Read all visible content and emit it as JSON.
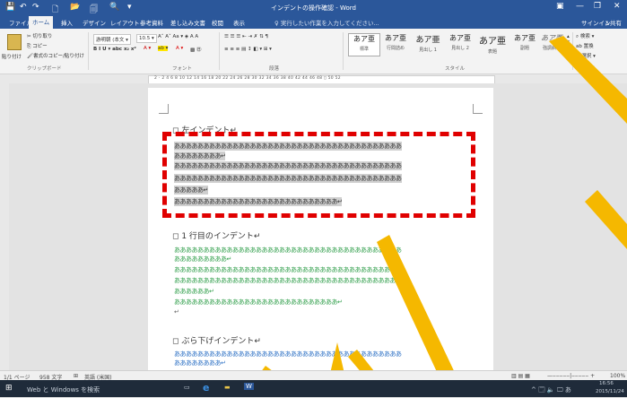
{
  "titlebar": {
    "title": "インデントの操作確認 - Word",
    "quick_access": [
      "💾",
      "↶",
      "↷",
      "🗋",
      "📂",
      "🗐",
      "🔍",
      "▾"
    ],
    "window_controls": [
      "▣",
      "—",
      "❐",
      "✕"
    ]
  },
  "tabs": [
    "ファイル",
    "ホーム",
    "挿入",
    "デザイン",
    "レイアウト",
    "参考資料",
    "差し込み文書",
    "校閲",
    "表示"
  ],
  "active_tab": "ホーム",
  "tellme": "実行したい作業を入力してください...",
  "account": {
    "signin": "サインイン",
    "share": "共有"
  },
  "ribbon": {
    "clipboard": {
      "paste": "貼り付け",
      "cut": "切り取り",
      "copy": "コピー",
      "format_painter": "書式のコピー/貼り付け",
      "label": "クリップボード"
    },
    "font": {
      "name": "游明朝 (本文 ▾",
      "size": "10.5 ▾",
      "label": "フォント",
      "row1_icons": "A˄ A˅ Aa ▾ ◈ A A",
      "row2_icons": "B I U ▾ abc x₂ x²"
    },
    "paragraph": {
      "label": "段落",
      "row1_icons": "☰ ☰ ☰ ⇤ ⇥ ✗ ⇅ ¶",
      "row2_icons": "≡ ≡ ≡ ▤ ↕ ◧ ▾ ⊞ ▾"
    },
    "styles": {
      "label": "スタイル",
      "items": [
        {
          "preview": "あア亜",
          "name": "標準"
        },
        {
          "preview": "あア亜",
          "name": "行間詰め"
        },
        {
          "preview": "あア亜",
          "name": "見出し 1"
        },
        {
          "preview": "あア亜",
          "name": "見出し 2"
        },
        {
          "preview": "あア亜",
          "name": "表題"
        },
        {
          "preview": "あア亜",
          "name": "副題"
        },
        {
          "preview": "あア亜",
          "name": "強調斜体"
        }
      ]
    },
    "editing": {
      "find": "検索 ▾",
      "replace": "置換",
      "select": "選択 ▾",
      "label": "編集"
    }
  },
  "ruler": {
    "numbers": "2  ·  2   4   6   8   10   12   14   16   18   20   22   24   26   28   30   32   34   36   38   40   42   44   46   48 ▯ 50   52"
  },
  "document": {
    "heading1": "◻ 左インデント↵",
    "para1": [
      "あああああああああああああああああああああああああああああああああああああああ",
      "ああああああああ↵",
      "あああああああああああああああああああああああああああああああああああああああ",
      "あああああああああああああああああああああああああああああああああああああああ",
      "あああああ↵",
      "ああああああああああああああああああああああああああああ↵"
    ],
    "heading2": "◻ 1 行目のインデント↵",
    "para2": [
      "あああああああああああああああああああああああああああああああああああああああ",
      "あああああああああ↵",
      "あああああああああああああああああああああああああああああああああああああああ",
      "あああああああああああああああああああああああああああああああああああああああ",
      "ああああああ↵",
      "ああああああああああああああああああああああああああああ↵",
      "↵"
    ],
    "heading3": "◻ ぶら下げインデント↵",
    "para3": [
      "あああああああああああああああああああああああああああああああああああああああ",
      "ああああああああ↵",
      "あああああああああああああああああああああああああああああああああああああああ"
    ]
  },
  "status": {
    "page": "1/1 ページ",
    "words": "958 文字",
    "proof": "⊞",
    "lang": "英語 (米国)",
    "zoom": "100%"
  },
  "taskbar": {
    "search": "Web と Windows を検索",
    "time": "16:56",
    "date": "2015/11/24",
    "tray": "^ 🗔 🔈 🖵 あ"
  },
  "colors": {
    "accent": "#2b579a",
    "highlight_box": "#e00000",
    "overlay": "#f5b800",
    "green_text": "#2f9e4a",
    "blue_text": "#2a6fc4"
  }
}
